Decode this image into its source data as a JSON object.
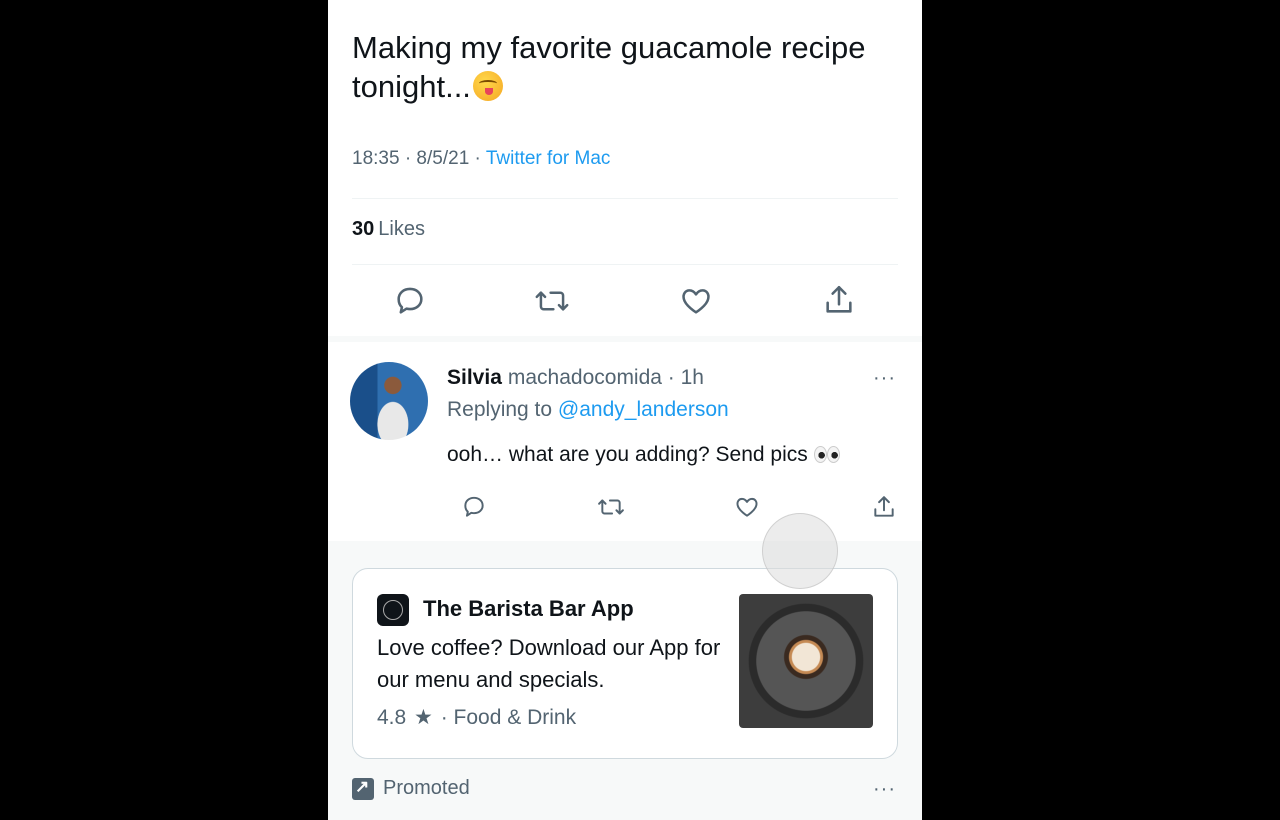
{
  "tweet": {
    "text": "Making my favorite guacamole recipe tonight...",
    "emoji": "yum-face-emoji",
    "time": "18:35 · 8/5/21 · ",
    "source": "Twitter for Mac",
    "likes_count": "30",
    "likes_label": "Likes"
  },
  "reply": {
    "name": "Silvia",
    "handle_meta": "machadocomida · 1h",
    "replying_prefix": "Replying to ",
    "replying_handle": "@andy_landerson",
    "text": "ooh… what are you adding? Send pics"
  },
  "promo": {
    "app_name": "The Barista Bar App",
    "description": "Love coffee? Download our App for our menu and specials.",
    "rating": "4.8",
    "star": "★",
    "category": " · Food & Drink",
    "promoted_label": "Promoted"
  },
  "more_label": "···",
  "colors": {
    "accent": "#1d9bf0",
    "text": "#0f1419",
    "secondary": "#536471"
  }
}
